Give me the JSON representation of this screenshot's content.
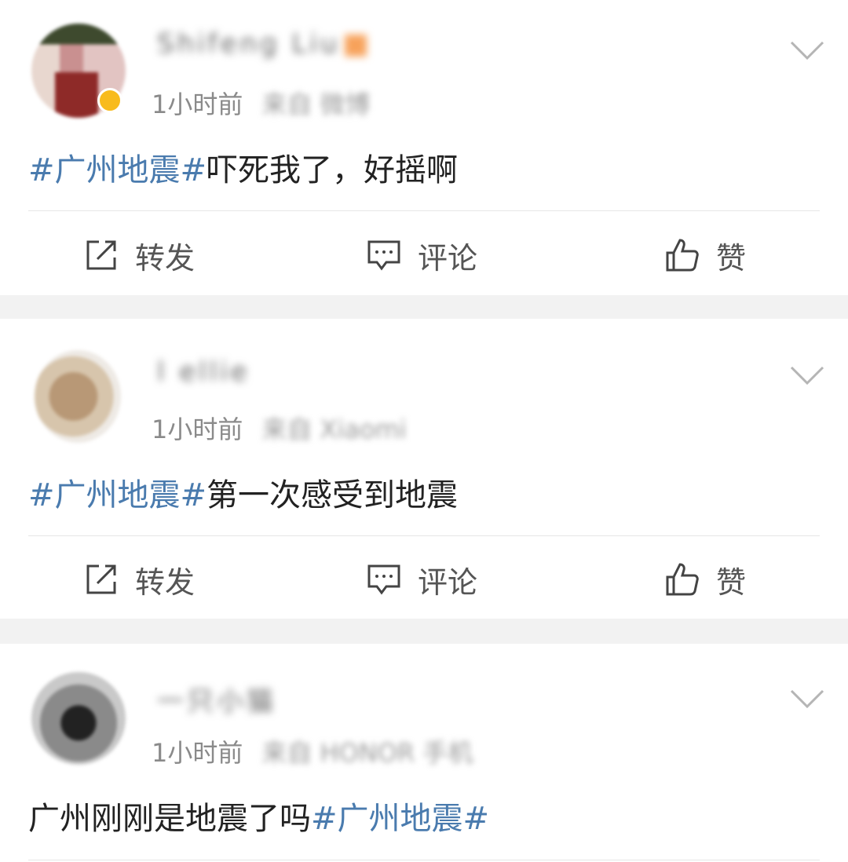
{
  "posts": [
    {
      "name": "Shifeng Liu",
      "time": "1小时前",
      "source": "来自 微博",
      "content": "吓死我了，好摇啊",
      "tag_prefix": "#广州地震#",
      "tag_suffix": ""
    },
    {
      "name": "l ellie",
      "time": "1小时前",
      "source": "来自 Xiaomi",
      "content": "第一次感受到地震",
      "tag_prefix": "#广州地震#",
      "tag_suffix": ""
    },
    {
      "name": "一只小猫",
      "time": "1小时前",
      "source": "来自 HONOR 手机",
      "content": "广州刚刚是地震了吗",
      "tag_prefix": "",
      "tag_suffix": "#广州地震#"
    }
  ],
  "actions": {
    "repost_label": "转发",
    "comment_label": "评论",
    "like_label": "赞"
  },
  "colors": {
    "hashtag": "#4a7bae",
    "text": "#222222",
    "meta": "#8a8a8a",
    "background": "#f2f2f2"
  },
  "icons": {
    "menu": "chevron-down-icon",
    "repost": "share-icon",
    "comment": "comment-icon",
    "like": "thumbs-up-icon"
  }
}
